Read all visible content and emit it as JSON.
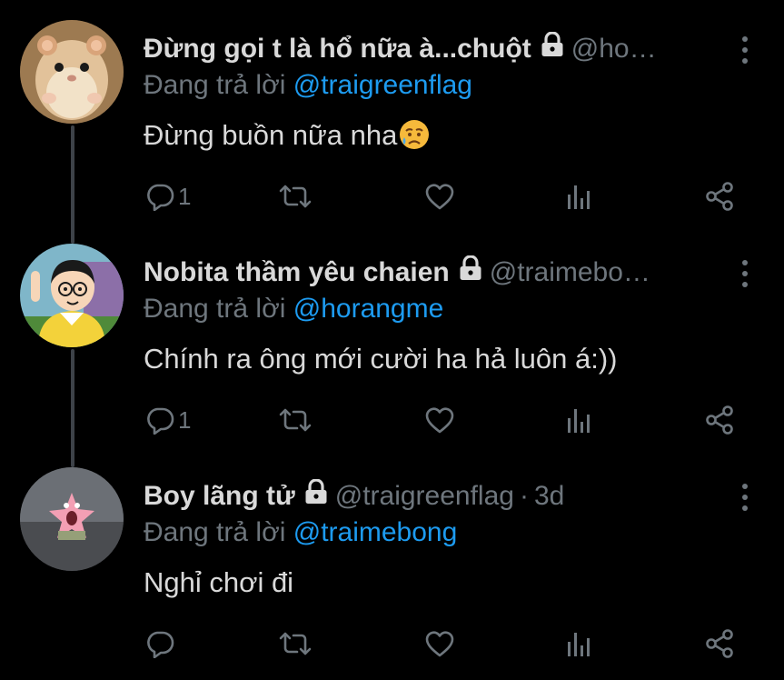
{
  "tweets": [
    {
      "display_name": "Đừng gọi t là hổ nữa à...chuột",
      "handle": "@ho…",
      "time": "",
      "replying_to_prefix": "Đang trả lời",
      "replying_to": "@traigreenflag",
      "text": "Đừng buồn nữa nha",
      "emoji": "sad-relieved-face",
      "reply_count": "1",
      "avatar": "hamster-avatar"
    },
    {
      "display_name": "Nobita thầm yêu chaien",
      "handle": "@traimebo…",
      "time": "",
      "replying_to_prefix": "Đang trả lời",
      "replying_to": "@horangme",
      "text": "Chính ra ông mới cười ha hả luôn á:))",
      "reply_count": "1",
      "avatar": "nobita-avatar"
    },
    {
      "display_name": "Boy lãng tử",
      "handle": "@traigreenflag",
      "time": "3d",
      "time_separator": "·",
      "replying_to_prefix": "Đang trả lời",
      "replying_to": "@traimebong",
      "text": "Nghỉ chơi đi",
      "reply_count": "",
      "avatar": "patrick-avatar"
    }
  ],
  "colors": {
    "background": "#000000",
    "primary_text": "#d9d9d9",
    "secondary_text": "#6e767d",
    "link": "#1d9bf0",
    "thread_line": "#3d4248"
  },
  "icons": [
    "lock-icon",
    "more-icon",
    "reply-icon",
    "retweet-icon",
    "like-icon",
    "analytics-icon",
    "share-icon"
  ]
}
